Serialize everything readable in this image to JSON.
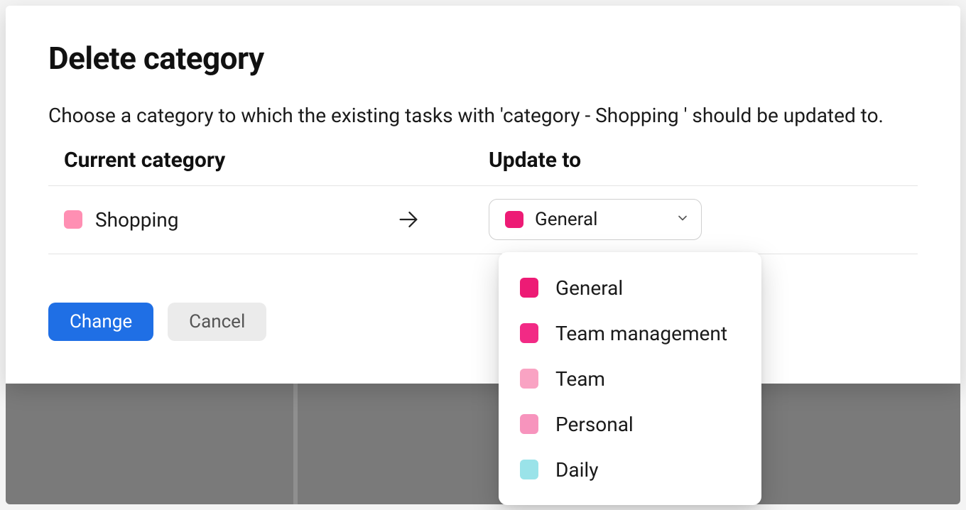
{
  "dialog": {
    "title": "Delete category",
    "description": "Choose a category to which the existing tasks with 'category - Shopping ' should be updated to.",
    "columns": {
      "current": "Current category",
      "update": "Update to"
    },
    "current_category": {
      "name": "Shopping",
      "color": "#ff8fb3"
    },
    "selected_target": {
      "name": "General",
      "color": "#ed1b75"
    },
    "options": [
      {
        "name": "General",
        "color": "#ed1b75"
      },
      {
        "name": "Team management",
        "color": "#f22a85"
      },
      {
        "name": "Team",
        "color": "#f9a3c3"
      },
      {
        "name": "Personal",
        "color": "#f794bd"
      },
      {
        "name": "Daily",
        "color": "#9ae3e9"
      }
    ],
    "actions": {
      "change": "Change",
      "cancel": "Cancel"
    }
  }
}
